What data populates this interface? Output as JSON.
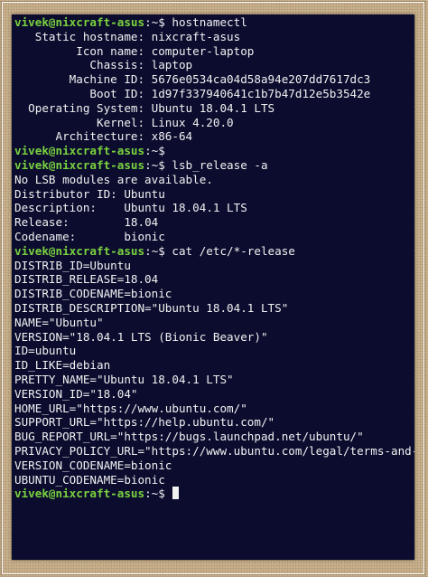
{
  "prompt": {
    "user_host": "vivek@nixcraft-asus",
    "suffix": ":~$"
  },
  "lines": [
    {
      "type": "prompt",
      "command": " hostnamectl"
    },
    {
      "type": "output",
      "text": "   Static hostname: nixcraft-asus"
    },
    {
      "type": "output",
      "text": "         Icon name: computer-laptop"
    },
    {
      "type": "output",
      "text": "           Chassis: laptop"
    },
    {
      "type": "output",
      "text": "        Machine ID: 5676e0534ca04d58a94e207dd7617dc3"
    },
    {
      "type": "output",
      "text": "           Boot ID: 1d97f337940641c1b7b47d12e5b3542e"
    },
    {
      "type": "output",
      "text": "  Operating System: Ubuntu 18.04.1 LTS"
    },
    {
      "type": "output",
      "text": "            Kernel: Linux 4.20.0"
    },
    {
      "type": "output",
      "text": "      Architecture: x86-64"
    },
    {
      "type": "prompt",
      "command": ""
    },
    {
      "type": "prompt",
      "command": " lsb_release -a"
    },
    {
      "type": "output",
      "text": "No LSB modules are available."
    },
    {
      "type": "output",
      "text": "Distributor ID:\tUbuntu"
    },
    {
      "type": "output",
      "text": "Description:\tUbuntu 18.04.1 LTS"
    },
    {
      "type": "output",
      "text": "Release:\t18.04"
    },
    {
      "type": "output",
      "text": "Codename:\tbionic"
    },
    {
      "type": "prompt",
      "command": " cat /etc/*-release"
    },
    {
      "type": "output",
      "text": "DISTRIB_ID=Ubuntu"
    },
    {
      "type": "output",
      "text": "DISTRIB_RELEASE=18.04"
    },
    {
      "type": "output",
      "text": "DISTRIB_CODENAME=bionic"
    },
    {
      "type": "output",
      "text": "DISTRIB_DESCRIPTION=\"Ubuntu 18.04.1 LTS\""
    },
    {
      "type": "output",
      "text": "NAME=\"Ubuntu\""
    },
    {
      "type": "output",
      "text": "VERSION=\"18.04.1 LTS (Bionic Beaver)\""
    },
    {
      "type": "output",
      "text": "ID=ubuntu"
    },
    {
      "type": "output",
      "text": "ID_LIKE=debian"
    },
    {
      "type": "output",
      "text": "PRETTY_NAME=\"Ubuntu 18.04.1 LTS\""
    },
    {
      "type": "output",
      "text": "VERSION_ID=\"18.04\""
    },
    {
      "type": "output",
      "text": "HOME_URL=\"https://www.ubuntu.com/\""
    },
    {
      "type": "output",
      "text": "SUPPORT_URL=\"https://help.ubuntu.com/\""
    },
    {
      "type": "output",
      "text": "BUG_REPORT_URL=\"https://bugs.launchpad.net/ubuntu/\""
    },
    {
      "type": "output",
      "text": "PRIVACY_POLICY_URL=\"https://www.ubuntu.com/legal/terms-and-policies/privacy-policy\""
    },
    {
      "type": "output",
      "text": "VERSION_CODENAME=bionic"
    },
    {
      "type": "output",
      "text": "UBUNTU_CODENAME=bionic"
    },
    {
      "type": "prompt",
      "command": " ",
      "cursor": true
    }
  ],
  "colors": {
    "background": "#0b0c2e",
    "prompt": "#7ad23f",
    "text": "#f2f2f2"
  }
}
